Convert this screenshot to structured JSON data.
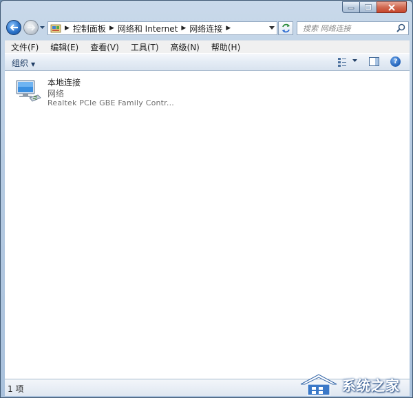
{
  "window": {
    "caption_buttons": [
      "minimize",
      "maximize",
      "close"
    ]
  },
  "address_bar": {
    "crumbs": [
      "控制面板",
      "网络和 Internet",
      "网络连接"
    ]
  },
  "search": {
    "placeholder": "搜索 网络连接"
  },
  "menu": {
    "items": [
      "文件(F)",
      "编辑(E)",
      "查看(V)",
      "工具(T)",
      "高级(N)",
      "帮助(H)"
    ]
  },
  "toolbar": {
    "organize_label": "组织",
    "help_label": "?"
  },
  "connection": {
    "name": "本地连接",
    "status": "网络",
    "device": "Realtek PCIe GBE Family Contr..."
  },
  "statusbar": {
    "count": "1 项"
  },
  "watermark": {
    "text": "系统之家"
  },
  "colors": {
    "frame": "#b6cbe2",
    "content_bg": "#ffffff",
    "close_button": "#c7452a",
    "toolbar_text": "#1e3c64"
  }
}
